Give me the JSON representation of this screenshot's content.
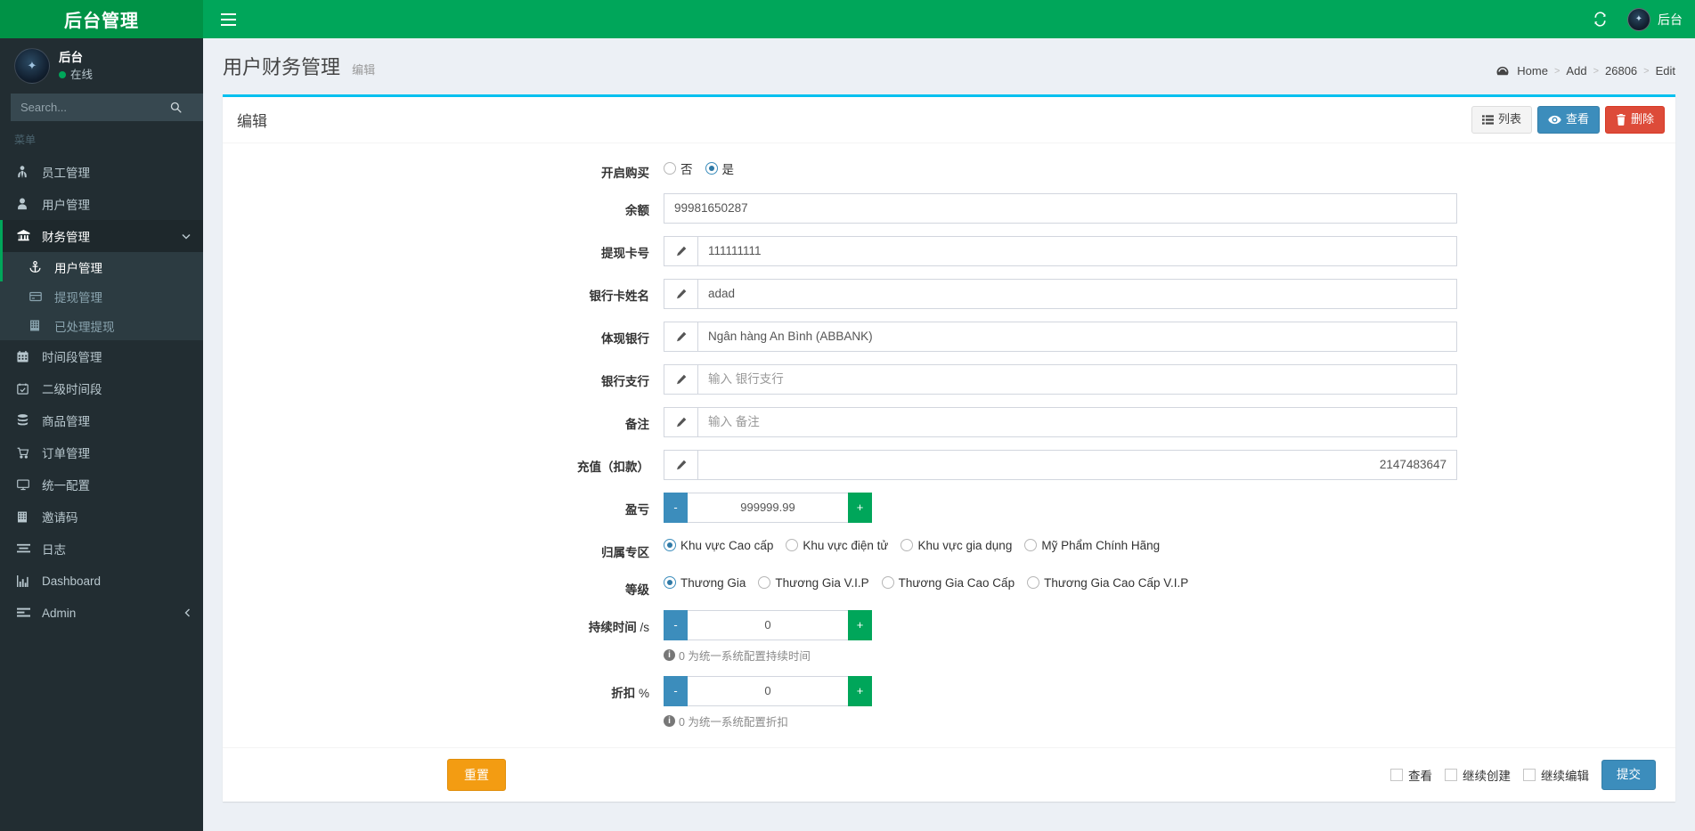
{
  "brand": {
    "title": "后台管理"
  },
  "navbar": {
    "toggle_icon": "hamburger-icon",
    "refresh_icon": "refresh-icon",
    "user_name": "后台"
  },
  "sidebar": {
    "user": {
      "name": "后台",
      "status": "在线"
    },
    "search": {
      "placeholder": "Search...",
      "value": "",
      "icon": "search-icon"
    },
    "menu_header": "菜单",
    "items": [
      {
        "label": "员工管理",
        "icon": "user-tie-icon",
        "active": false
      },
      {
        "label": "用户管理",
        "icon": "user-icon",
        "active": false
      },
      {
        "label": "财务管理",
        "icon": "bank-icon",
        "active": true,
        "caret": "chevron-down-icon",
        "children": [
          {
            "label": "用户管理",
            "icon": "anchor-icon",
            "active": true
          },
          {
            "label": "提现管理",
            "icon": "card-icon",
            "active": false
          },
          {
            "label": "已处理提现",
            "icon": "building-icon",
            "active": false
          }
        ]
      },
      {
        "label": "时间段管理",
        "icon": "calendar-icon",
        "active": false
      },
      {
        "label": "二级时间段",
        "icon": "calendar-check-icon",
        "active": false
      },
      {
        "label": "商品管理",
        "icon": "database-icon",
        "active": false
      },
      {
        "label": "订单管理",
        "icon": "cart-icon",
        "active": false
      },
      {
        "label": "统一配置",
        "icon": "desktop-icon",
        "active": false
      },
      {
        "label": "邀请码",
        "icon": "keyboard-icon",
        "active": false
      },
      {
        "label": "日志",
        "icon": "align-icon",
        "active": false
      },
      {
        "label": "Dashboard",
        "icon": "chart-bar-icon",
        "active": false
      },
      {
        "label": "Admin",
        "icon": "list-icon",
        "active": false,
        "caret": "chevron-left-icon"
      }
    ]
  },
  "page": {
    "title": "用户财务管理",
    "subtitle": "编辑",
    "breadcrumb": [
      {
        "label": "Home",
        "icon": "dashboard-icon"
      },
      {
        "label": "Add"
      },
      {
        "label": "26806"
      },
      {
        "label": "Edit"
      }
    ]
  },
  "box": {
    "title": "编辑",
    "tools": [
      {
        "label": "列表",
        "icon": "list-icon",
        "style": "default"
      },
      {
        "label": "查看",
        "icon": "eye-icon",
        "style": "primary"
      },
      {
        "label": "删除",
        "icon": "trash-icon",
        "style": "danger"
      }
    ]
  },
  "form": {
    "purchase_enable": {
      "label": "开启购买",
      "options": [
        {
          "label": "否",
          "checked": false
        },
        {
          "label": "是",
          "checked": true
        }
      ]
    },
    "balance": {
      "label": "余额",
      "value": "99981650287",
      "placeholder": ""
    },
    "withdraw_card": {
      "label": "提现卡号",
      "value": "111111111",
      "placeholder": "",
      "addon_icon": "pencil-icon"
    },
    "card_name": {
      "label": "银行卡姓名",
      "value": "adad",
      "placeholder": "",
      "addon_icon": "pencil-icon"
    },
    "bank": {
      "label": "体现银行",
      "value": "Ngân hàng An Bình (ABBANK)",
      "placeholder": "",
      "addon_icon": "pencil-icon"
    },
    "branch": {
      "label": "银行支行",
      "value": "",
      "placeholder": "输入 银行支行",
      "addon_icon": "pencil-icon"
    },
    "remark": {
      "label": "备注",
      "value": "",
      "placeholder": "输入 备注",
      "addon_icon": "pencil-icon"
    },
    "recharge": {
      "label": "充值（扣款）",
      "value": "2147483647",
      "placeholder": "",
      "addon_icon": "pencil-icon"
    },
    "profit_loss": {
      "label": "盈亏",
      "value": "999999.99",
      "minus": "-",
      "plus": "+"
    },
    "zone": {
      "label": "归属专区",
      "options": [
        {
          "label": "Khu vực Cao cấp",
          "checked": true
        },
        {
          "label": "Khu vực điện tử",
          "checked": false
        },
        {
          "label": "Khu vực gia dụng",
          "checked": false
        },
        {
          "label": "Mỹ Phẩm Chính Hãng",
          "checked": false
        }
      ]
    },
    "level": {
      "label": "等级",
      "options": [
        {
          "label": "Thương Gia",
          "checked": true
        },
        {
          "label": "Thương Gia V.I.P",
          "checked": false
        },
        {
          "label": "Thương Gia Cao Cấp",
          "checked": false
        },
        {
          "label": "Thương Gia Cao Cấp V.I.P",
          "checked": false
        }
      ]
    },
    "duration": {
      "label": "持续时间",
      "unit": "/s",
      "value": "0",
      "minus": "-",
      "plus": "+",
      "help": "0 为统一系统配置持续时间"
    },
    "discount": {
      "label": "折扣",
      "unit": "%",
      "value": "0",
      "minus": "-",
      "plus": "+",
      "help": "0 为统一系统配置折扣"
    }
  },
  "footer": {
    "reset_label": "重置",
    "checkboxes": [
      {
        "label": "查看",
        "checked": false
      },
      {
        "label": "继续创建",
        "checked": false
      },
      {
        "label": "继续编辑",
        "checked": false
      }
    ],
    "submit_label": "提交"
  },
  "colors": {
    "brand_green": "#009246",
    "navbar_green": "#00a65a",
    "sidebar_dark": "#222d32",
    "submenu_dark": "#2c3b41",
    "box_accent": "#00c0ef",
    "primary": "#3c8dbc",
    "danger": "#dd4b39",
    "warning": "#f39c12",
    "content_bg": "#ecf0f5"
  }
}
